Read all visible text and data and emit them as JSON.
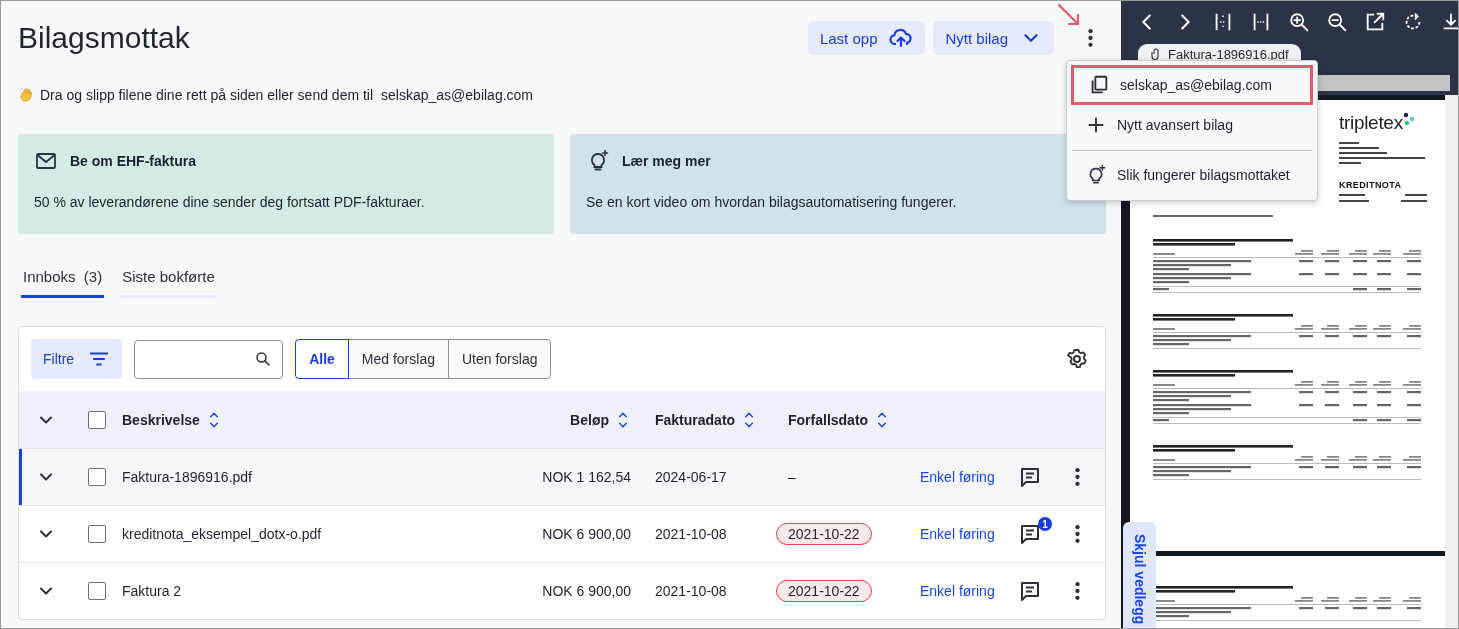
{
  "header": {
    "title": "Bilagsmottak",
    "buttons": [
      {
        "kind": "upload",
        "label": "Last opp"
      },
      {
        "kind": "dropdown",
        "label": "Nytt bilag"
      }
    ]
  },
  "hint": {
    "text": "Dra og slipp filene dine rett på siden eller send dem til",
    "email": "selskap_as@ebilag.com"
  },
  "cards": [
    {
      "kind": "mail",
      "title": "Be om EHF-faktura",
      "text": "50 % av leverandørene dine sender deg fortsatt PDF-fakturaer."
    },
    {
      "kind": "bulb",
      "title": "Lær meg mer",
      "text": "Se en kort video om hvordan bilagsautomatisering fungerer."
    }
  ],
  "tabs": [
    {
      "label": "Innboks",
      "count": "(3)",
      "selected": true
    },
    {
      "label": "Siste bokførte",
      "selected": false
    }
  ],
  "toolbar": {
    "filter_button": "Filtre",
    "segments": [
      {
        "label": "Alle",
        "selected": true
      },
      {
        "label": "Med forslag",
        "selected": false
      },
      {
        "label": "Uten forslag",
        "selected": false
      }
    ]
  },
  "table": {
    "select_all_checked": false,
    "columns": [
      "Beskrivelse",
      "Beløp",
      "Fakturadato",
      "Forfallsdato"
    ],
    "rows": [
      {
        "description": "Faktura-1896916.pdf",
        "amount": "NOK 1 162,54",
        "invoice_date": "2024-06-17",
        "due_date": "–",
        "overdue": false,
        "action": "Enkel føring",
        "selected": true,
        "checked": false
      },
      {
        "description": "kreditnota_eksempel_dotx-o.pdf",
        "amount": "NOK 6 900,00",
        "invoice_date": "2021-10-08",
        "due_date": "2021-10-22",
        "overdue": true,
        "action": "Enkel føring",
        "comment_count": "1",
        "selected": false,
        "checked": false
      },
      {
        "description": "Faktura 2",
        "amount": "NOK 6 900,00",
        "invoice_date": "2021-10-08",
        "due_date": "2021-10-22",
        "overdue": true,
        "action": "Enkel føring",
        "selected": false,
        "checked": false
      }
    ]
  },
  "menu": {
    "items": [
      {
        "kind": "copy",
        "label": "selskap_as@ebilag.com",
        "highlighted": true
      },
      {
        "kind": "plus",
        "label": "Nytt avansert bilag",
        "highlighted": false
      },
      {
        "kind": "bulb",
        "label": "Slik fungerer bilagsmottaket",
        "highlighted": false
      }
    ]
  },
  "viewer": {
    "file_tab": "Faktura-1896916.pdf",
    "hide_tab": "Skjul vedlegg",
    "document": {
      "logo": "tripletex",
      "title": "KREDITNOTA"
    }
  }
}
